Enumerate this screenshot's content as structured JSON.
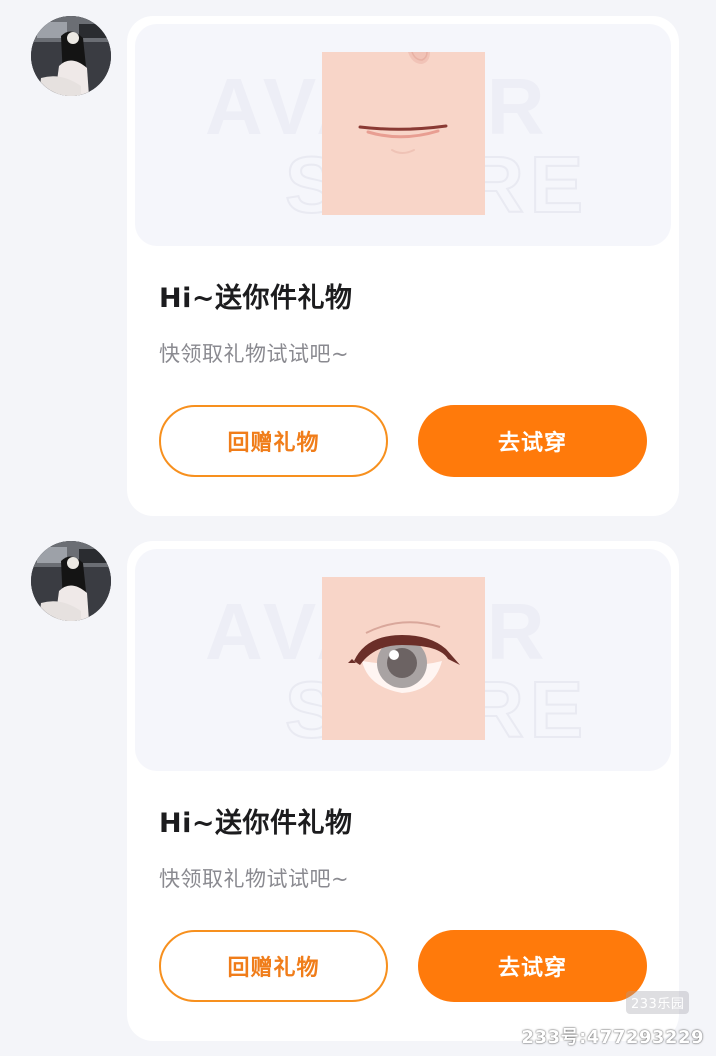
{
  "messages": [
    {
      "watermark_top": "AVATAR",
      "watermark_bottom": "STORE",
      "item_icon": "mouth-icon",
      "title": "Hi~送你件礼物",
      "subtitle": "快领取礼物试试吧~",
      "return_gift_label": "回赠礼物",
      "try_on_label": "去试穿"
    },
    {
      "watermark_top": "AVATAR",
      "watermark_bottom": "STORE",
      "item_icon": "eye-icon",
      "title": "Hi~送你件礼物",
      "subtitle": "快领取礼物试试吧~",
      "return_gift_label": "回赠礼物",
      "try_on_label": "去试穿"
    }
  ],
  "overlay": {
    "logo_text": "233乐园",
    "account_id": "233号:477293229"
  },
  "colors": {
    "accent": "#ff7a0b",
    "accent_border": "#f7901e",
    "skin": "#f8d5c8"
  }
}
